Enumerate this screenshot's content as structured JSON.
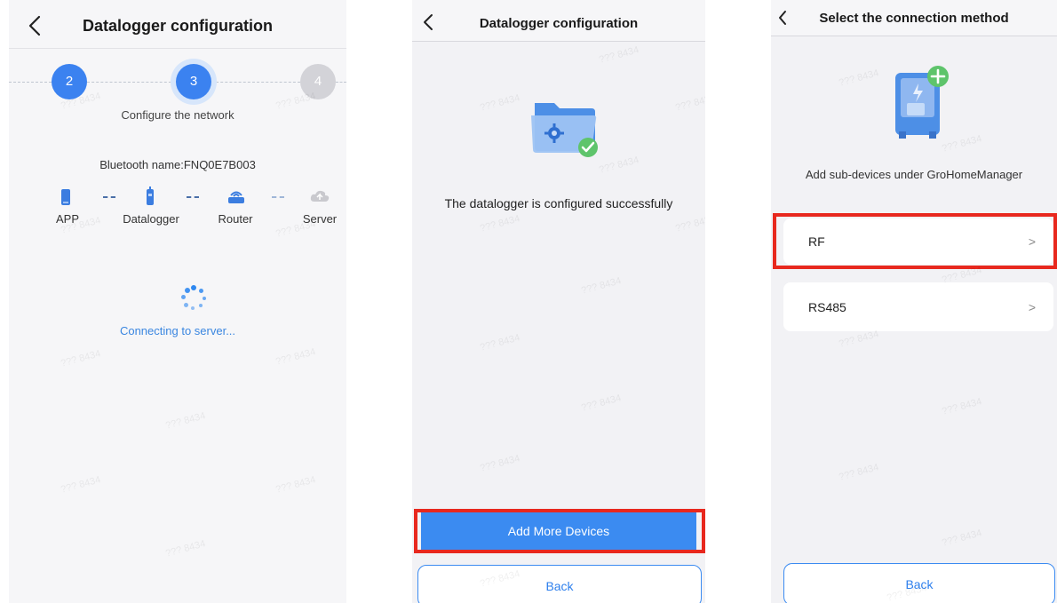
{
  "screen1": {
    "title": "Datalogger configuration",
    "steps": [
      "2",
      "3",
      "4"
    ],
    "step_caption": "Configure the network",
    "bluetooth_name": "Bluetooth name:FNQ0E7B003",
    "devices": [
      "APP",
      "Datalogger",
      "Router",
      "Server"
    ],
    "status": "Connecting to server..."
  },
  "screen2": {
    "title": "Datalogger configuration",
    "message": "The datalogger is configured successfully",
    "add_button": "Add More Devices",
    "back_button": "Back"
  },
  "screen3": {
    "title": "Select the connection method",
    "subtitle": "Add sub-devices under GroHomeManager",
    "options": [
      {
        "label": "RF",
        "chevron": ">"
      },
      {
        "label": "RS485",
        "chevron": ">"
      }
    ],
    "back_button": "Back"
  },
  "watermark": "??? 8434",
  "colors": {
    "primary": "#3b8bf1",
    "highlight": "#e8281e",
    "inactive_step": "#d3d3d8",
    "success": "#5ec46b"
  }
}
